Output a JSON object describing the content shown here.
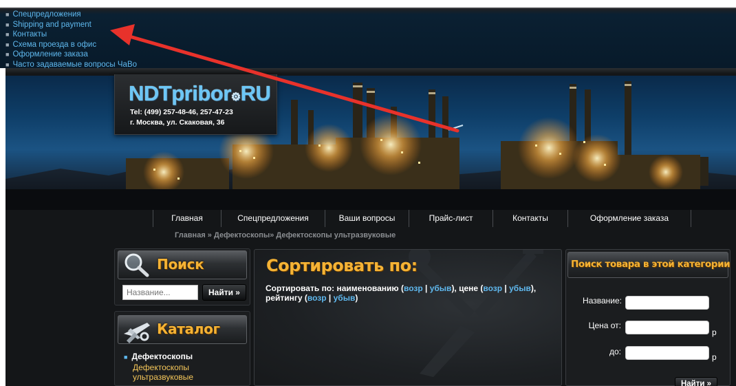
{
  "top_links": [
    "Спецпредложения",
    "Shipping and payment",
    "Контакты",
    "Схема проезда в офис",
    "Оформление заказа",
    "Часто задаваемые вопросы ЧаВо"
  ],
  "logo": {
    "text": "NDTpribor",
    "domain": "RU",
    "tel": "Tel: (499) 257-48-46, 257-47-23",
    "address": "г. Москва, ул. Скаковая, 36"
  },
  "nav": [
    "Главная",
    "Спецпредложения",
    "Ваши вопросы",
    "Прайс-лист",
    "Контакты",
    "Оформление заказа"
  ],
  "breadcrumb": {
    "home": "Главная",
    "sep1": " » ",
    "level1": "Дефектоскопы",
    "sep2": "» ",
    "current": "Дефектоскопы ультразвуковые"
  },
  "search": {
    "title": "Поиск",
    "placeholder": "Название...",
    "button": "Найти »"
  },
  "catalog": {
    "title": "Каталог",
    "item": "Дефектоскопы",
    "subitem": "Дефектоскопы ультразвуковые"
  },
  "sort": {
    "title": "Сортировать по:",
    "prefix": "Сортировать по: наименованию (",
    "asc": "возр",
    "bar": " | ",
    "desc": "убыв",
    "mid1": "), цене (",
    "mid2": "), рейтингу (",
    "end": ")"
  },
  "category_search": {
    "title": "Поиск товара в этой категории",
    "name_label": "Название:",
    "price_from_label": "Цена от:",
    "price_to_label": "до:",
    "currency": "р",
    "button": "Найти »"
  },
  "colors": {
    "link": "#5fb8ee",
    "heading_gold": "#f5b335",
    "annotation_arrow": "#e8322b",
    "panel_bg": "#1b1d1f"
  },
  "icons": {
    "search_panel": "magnifier-icon",
    "catalog_panel": "airplane-tools-icon"
  }
}
